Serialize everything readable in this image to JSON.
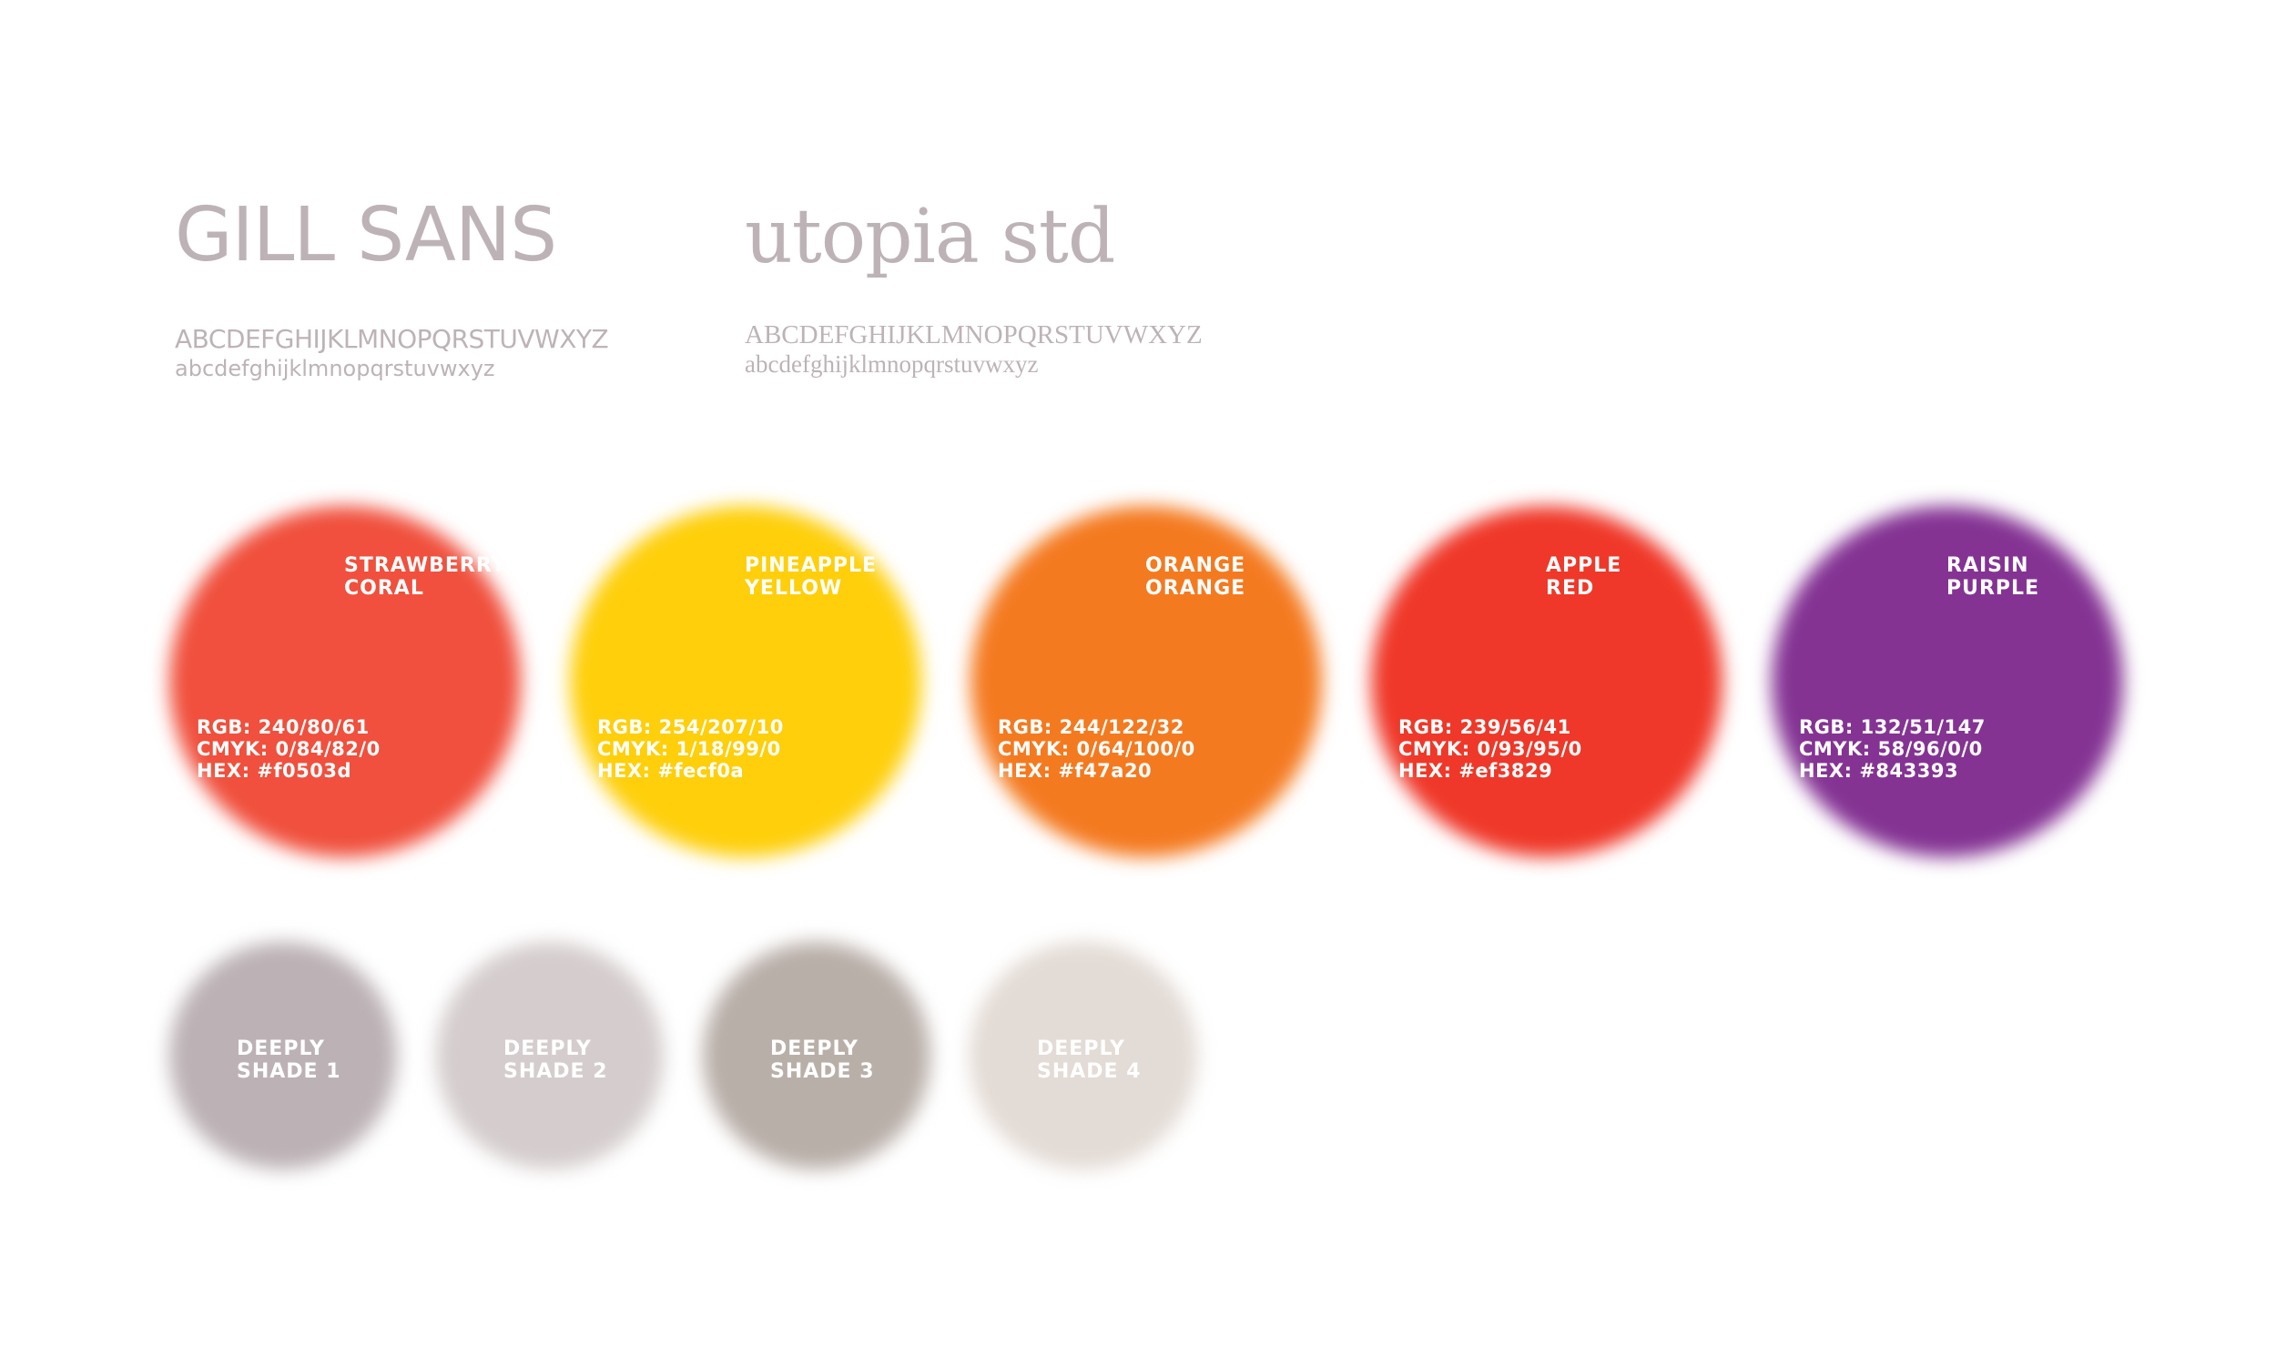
{
  "fonts": {
    "sans": {
      "name": "GILL SANS",
      "uppercase": "ABCDEFGHIJKLMNOPQRSTUVWXYZ",
      "lowercase": "abcdefghijklmnopqrstuvwxyz"
    },
    "serif": {
      "name": "utopia std",
      "uppercase": "ABCDEFGHIJKLMNOPQRSTUVWXYZ",
      "lowercase": "abcdefghijklmnopqrstuvwxyz"
    }
  },
  "colors": [
    {
      "line1": "STRAWBERRY",
      "line2": "CORAL",
      "rgb": "RGB: 240/80/61",
      "cmyk": "CMYK: 0/84/82/0",
      "hex_label": "HEX: #f0503d",
      "hex": "#f0503d"
    },
    {
      "line1": "PINEAPPLE",
      "line2": "YELLOW",
      "rgb": "RGB: 254/207/10",
      "cmyk": "CMYK: 1/18/99/0",
      "hex_label": "HEX: #fecf0a",
      "hex": "#fecf0a"
    },
    {
      "line1": "ORANGE",
      "line2": "ORANGE",
      "rgb": "RGB: 244/122/32",
      "cmyk": "CMYK: 0/64/100/0",
      "hex_label": "HEX: #f47a20",
      "hex": "#f47a20"
    },
    {
      "line1": "APPLE",
      "line2": "RED",
      "rgb": "RGB: 239/56/41",
      "cmyk": "CMYK: 0/93/95/0",
      "hex_label": "HEX: #ef3829",
      "hex": "#ef3829"
    },
    {
      "line1": "RAISIN",
      "line2": "PURPLE",
      "rgb": "RGB: 132/51/147",
      "cmyk": "CMYK: 58/96/0/0",
      "hex_label": "HEX: #843393",
      "hex": "#843393"
    }
  ],
  "shades": [
    {
      "line1": "DEEPLY",
      "line2": "SHADE 1",
      "hex": "#bcb2b5"
    },
    {
      "line1": "DEEPLY",
      "line2": "SHADE 2",
      "hex": "#d5cdcd"
    },
    {
      "line1": "DEEPLY",
      "line2": "SHADE 3",
      "hex": "#b9afa9"
    },
    {
      "line1": "DEEPLY",
      "line2": "SHADE 4",
      "hex": "#e3dbd5"
    }
  ]
}
